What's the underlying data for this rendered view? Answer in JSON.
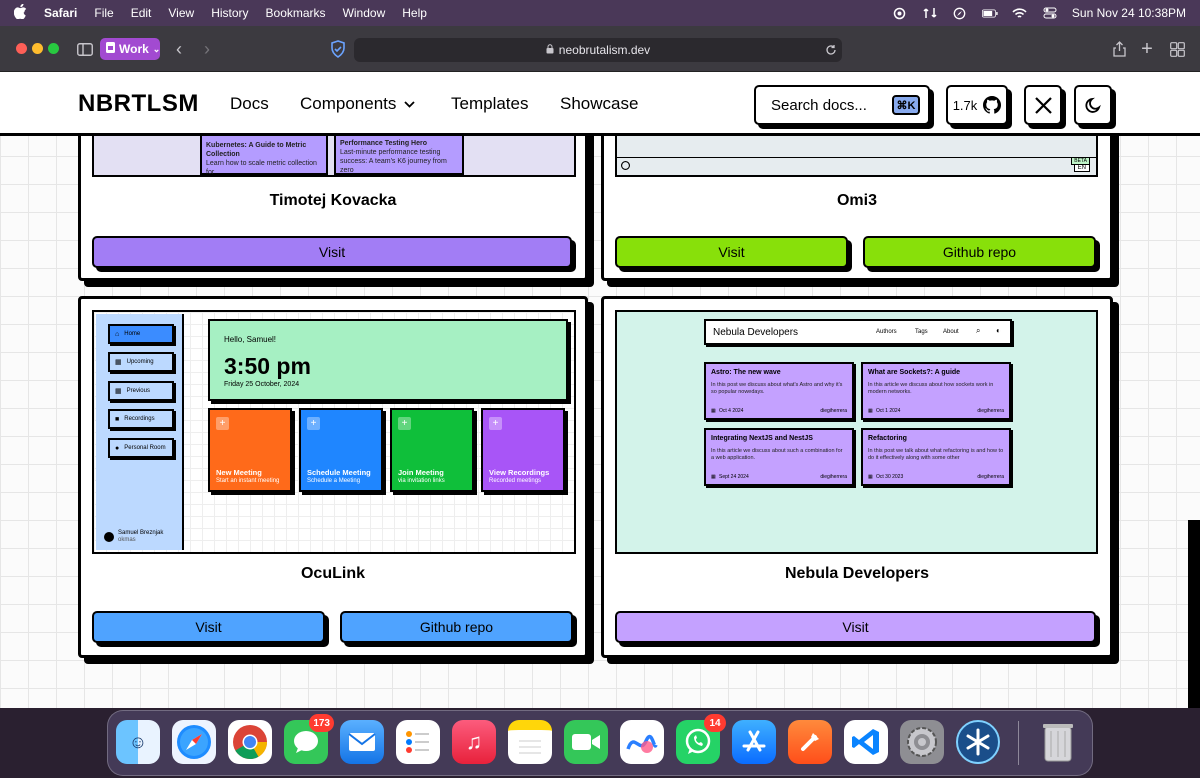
{
  "menubar": {
    "app": "Safari",
    "items": [
      "File",
      "Edit",
      "View",
      "History",
      "Bookmarks",
      "Window",
      "Help"
    ],
    "clock": "Sun Nov 24  10:38PM"
  },
  "browser": {
    "profile": "Work",
    "url": "neobrutalism.dev"
  },
  "site": {
    "logo": "NBRTLSM",
    "nav": {
      "docs": "Docs",
      "components": "Components",
      "templates": "Templates",
      "showcase": "Showcase"
    },
    "search_placeholder": "Search docs...",
    "search_kbd": "⌘K",
    "stars": "1.7k"
  },
  "cards": {
    "timotej": {
      "title": "Timotej Kovacka",
      "visit": "Visit",
      "preview": {
        "post1": "Kubernetes: A Guide to Metric Collection",
        "post1_desc": "Learn how to scale metric collection for",
        "post2": "Performance Testing Hero",
        "post2_desc": "Last-minute performance testing success: A team's K6 journey from zero"
      }
    },
    "omi3": {
      "title": "Omi3",
      "visit": "Visit",
      "repo": "Github repo",
      "preview": {
        "badge": "BETA",
        "lang": "EN"
      }
    },
    "oculink": {
      "title": "OcuLink",
      "visit": "Visit",
      "repo": "Github repo",
      "preview": {
        "sidebar": [
          "Home",
          "Upcoming",
          "Previous",
          "Recordings",
          "Personal Room"
        ],
        "user_name": "Samuel Breznjak",
        "user_handle": "okmas",
        "greeting": "Hello, Samuel!",
        "time": "3:50 pm",
        "date": "Friday 25 October, 2024",
        "tiles": [
          {
            "title": "New Meeting",
            "sub": "Start an instant meeting",
            "color": "#ff6a1a"
          },
          {
            "title": "Schedule Meeting",
            "sub": "Schedule a Meeting",
            "color": "#1f86ff"
          },
          {
            "title": "Join Meeting",
            "sub": "via invitation links",
            "color": "#0fbf3a"
          },
          {
            "title": "View Recordings",
            "sub": "Recorded meetings",
            "color": "#a855f7"
          }
        ]
      }
    },
    "nebula": {
      "title": "Nebula Developers",
      "visit": "Visit",
      "preview": {
        "site_title": "Nebula Developers",
        "links": [
          "Authors",
          "Tags",
          "About"
        ],
        "posts": [
          {
            "title": "Astro: The new wave",
            "desc": "In this post we discuss about what's Astro and why it's so popular nowedays.",
            "date": "Oct 4 2024",
            "author": "diegiherrera"
          },
          {
            "title": "What are Sockets?: A guide",
            "desc": "In this article we discuss about how sockets work in modern networks.",
            "date": "Oct 1 2024",
            "author": "diegiherrera"
          },
          {
            "title": "Integrating NextJS and NestJS",
            "desc": "In this article we discuss about such a combination for a web application.",
            "date": "Sept 24 2024",
            "author": "diegiherrera"
          },
          {
            "title": "Refactoring",
            "desc": "In this post we talk about what refactoring is and how to do it effectively along with some other",
            "date": "Oct 30 2023",
            "author": "diegiherrera"
          }
        ]
      }
    }
  },
  "dock": {
    "messages_badge": "173",
    "whatsapp_badge": "14"
  }
}
